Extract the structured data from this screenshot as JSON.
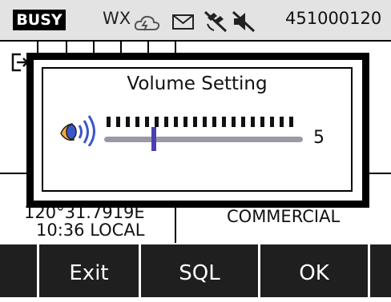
{
  "status_bar": {
    "busy": "BUSY",
    "wx": "WX",
    "mmsi": "451000120",
    "icons": [
      "cloud-icon",
      "mail-icon",
      "no-gps-icon",
      "mute-icon"
    ]
  },
  "background": {
    "coords": "120°31.7919E",
    "time": "10:36 LOCAL",
    "channel_type": "COMMERCIAL"
  },
  "dialog": {
    "title": "Volume Setting",
    "volume_value": "5",
    "volume_fraction": 0.25,
    "tick_count": 20
  },
  "softkeys": [
    "Exit",
    "SQL",
    "OK"
  ],
  "colors": {
    "status_bg": "#e3e3e3",
    "softkey_bg": "#1f1f1f",
    "slider_track": "#9a9aa6",
    "slider_thumb": "#4a3fb0",
    "speaker_accent": "#f2a93b",
    "speaker_waves": "#3a57c9"
  }
}
